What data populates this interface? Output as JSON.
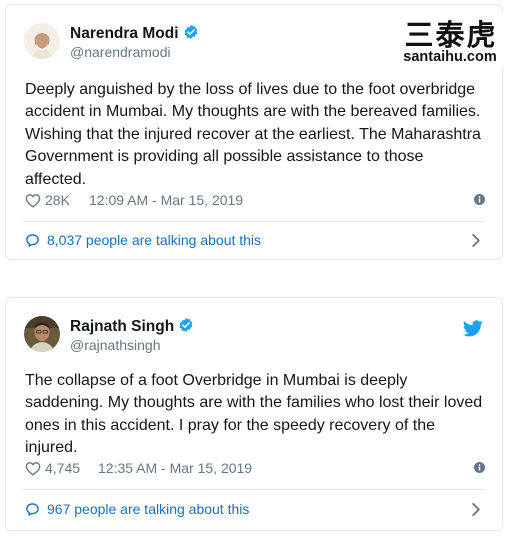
{
  "watermark": {
    "cn": "三泰虎",
    "en": "santaihu.com"
  },
  "tweets": [
    {
      "author": "Narendra Modi",
      "handle": "@narendramodi",
      "text": "Deeply anguished by the loss of lives due to the foot overbridge accident in Mumbai. My thoughts are with the bereaved families. Wishing that the injured recover at the earliest. The Maharashtra Government is providing all possible assistance to those affected.",
      "likes": "28K",
      "timestamp": "12:09 AM - Mar 15, 2019",
      "talking": "8,037 people are talking about this"
    },
    {
      "author": "Rajnath Singh",
      "handle": "@rajnathsingh",
      "text": "The collapse of a foot Overbridge in Mumbai is deeply saddening. My thoughts are with the families who lost their loved ones in this accident. I pray for the speedy recovery of the injured.",
      "likes": "4,745",
      "timestamp": "12:35 AM - Mar 15, 2019",
      "talking": "967 people are talking about this"
    }
  ],
  "icons": {
    "verified": "verified-badge-icon",
    "heart": "heart-icon",
    "info": "info-icon",
    "reply_bubble": "speech-bubble-icon",
    "chevron": "chevron-right-icon",
    "twitter": "twitter-bird-icon"
  },
  "colors": {
    "accent_blue": "#1da1f2",
    "link_blue": "#1b6fbc",
    "muted_gray": "#657786",
    "border": "#e1e8ed"
  }
}
